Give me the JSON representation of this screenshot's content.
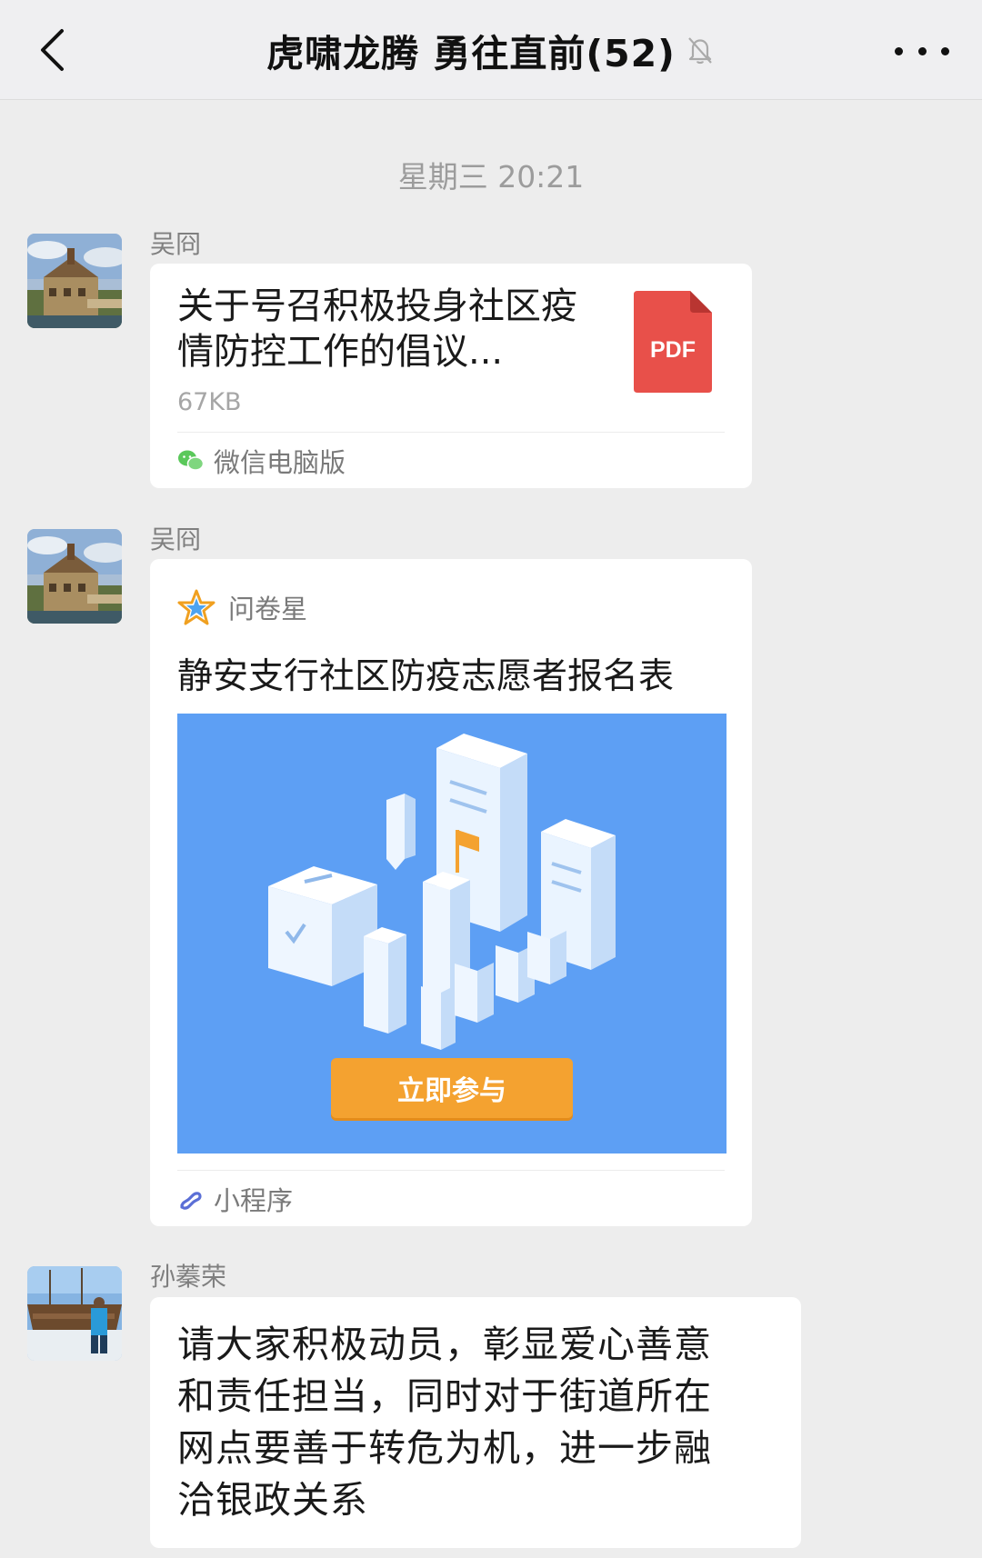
{
  "header": {
    "title": "虎啸龙腾 勇往直前(52)",
    "back_icon": "chevron-left-icon",
    "mute_icon": "bell-off-icon",
    "more_icon": "more-dots-icon"
  },
  "timestamp": "星期三 20:21",
  "messages": [
    {
      "sender": "吴冏",
      "type": "file",
      "file_title": "关于号召积极投身社区疫情防控工作的倡议...",
      "file_size": "67KB",
      "file_icon_label": "PDF",
      "source": "微信电脑版"
    },
    {
      "sender": "吴冏",
      "type": "mini-program",
      "source": "问卷星",
      "title": "静安支行社区防疫志愿者报名表",
      "button_label": "立即参与",
      "footer": "小程序"
    },
    {
      "sender": "孙蓁荣",
      "type": "text",
      "text": "请大家积极动员，彰显爱心善意和责任担当，同时对于街道所在网点要善于转危为机，进一步融洽银政关系"
    }
  ],
  "colors": {
    "background": "#ededed",
    "pdf_red": "#e8504a",
    "card_blue": "#5d9ff4",
    "button_orange": "#f4a230"
  }
}
